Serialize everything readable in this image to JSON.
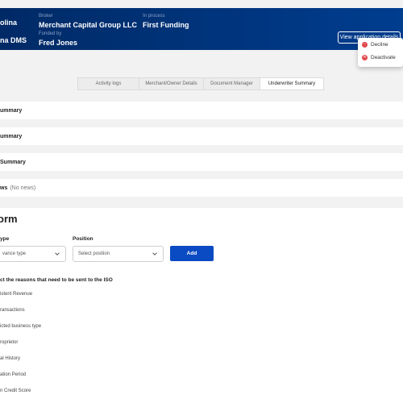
{
  "header": {
    "name_top": "olina",
    "name_bottom": "na DMS",
    "broker_label": "Broker",
    "broker_value": "Merchant Capital Group LLC",
    "funded_by_label": "Funded by",
    "funded_by_value": "Fred Jones",
    "status_label": "In process",
    "status_value": "First Funding",
    "view_button": "View application details"
  },
  "dropdown": {
    "items": [
      {
        "label": "Decline",
        "icon": "minus-circle-icon"
      },
      {
        "label": "Deactivate",
        "icon": "x-circle-icon"
      }
    ]
  },
  "tabs": [
    "Activity logs",
    "Merchant/Owner Details",
    "Document Manager",
    "Underwriter Summary"
  ],
  "active_tab": "Underwriter Summary",
  "summary_rows": [
    {
      "label": "ummary"
    },
    {
      "label": "ummary"
    },
    {
      "label": "Summary"
    },
    {
      "label": "ws",
      "note": "(No news)"
    }
  ],
  "form": {
    "title": "orm",
    "type_label": "ype",
    "type_placeholder": "vance type",
    "position_label": "Position",
    "position_placeholder": "Select position",
    "add_button": "Add",
    "reasons_title": "ct the reasons that need to be sent to the ISO",
    "reasons": [
      "istent Revenue",
      "ransactions",
      "icted business type",
      "roprietor",
      "al History",
      "ation Period",
      "n Credit Score"
    ]
  },
  "colors": {
    "header_bg": "#003d8f",
    "accent": "#0a4ac2",
    "danger": "#e0474c"
  }
}
